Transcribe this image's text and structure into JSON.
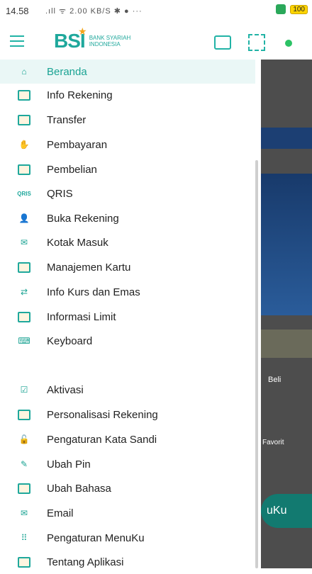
{
  "status_bar": {
    "time": "14.58",
    "icons": ".ıll ᯤ 2.00 KB/S ✱ ● ···",
    "battery": "100"
  },
  "app": {
    "logo_main": "BSI",
    "logo_sub_line1": "BANK SYARIAH",
    "logo_sub_line2": "INDONESIA"
  },
  "menu": {
    "items": [
      {
        "label": "Beranda",
        "icon": "home-icon"
      },
      {
        "label": "Info Rekening",
        "icon": "card-icon"
      },
      {
        "label": "Transfer",
        "icon": "transfer-icon"
      },
      {
        "label": "Pembayaran",
        "icon": "payment-icon"
      },
      {
        "label": "Pembelian",
        "icon": "purchase-icon"
      },
      {
        "label": "QRIS",
        "icon": "qris-icon"
      },
      {
        "label": "Buka Rekening",
        "icon": "open-account-icon"
      },
      {
        "label": "Kotak Masuk",
        "icon": "inbox-icon"
      },
      {
        "label": "Manajemen Kartu",
        "icon": "card-management-icon"
      },
      {
        "label": "Info Kurs dan Emas",
        "icon": "exchange-gold-icon"
      },
      {
        "label": "Informasi Limit",
        "icon": "limit-icon"
      },
      {
        "label": "Keyboard",
        "icon": "keyboard-icon"
      }
    ],
    "settings": [
      {
        "label": "Aktivasi",
        "icon": "activation-icon"
      },
      {
        "label": "Personalisasi Rekening",
        "icon": "personalize-account-icon"
      },
      {
        "label": "Pengaturan Kata Sandi",
        "icon": "password-icon"
      },
      {
        "label": "Ubah Pin",
        "icon": "pin-icon"
      },
      {
        "label": "Ubah Bahasa",
        "icon": "language-icon"
      },
      {
        "label": "Email",
        "icon": "email-icon"
      },
      {
        "label": "Pengaturan MenuKu",
        "icon": "menuku-icon"
      },
      {
        "label": "Tentang Aplikasi",
        "icon": "about-icon"
      }
    ]
  },
  "background": {
    "beli": "Beli",
    "favorit": "Favorit",
    "menuku": "uKu"
  },
  "colors": {
    "primary": "#1fa89c",
    "accent": "#f3a51b",
    "overlay": "#4d4d4d"
  }
}
